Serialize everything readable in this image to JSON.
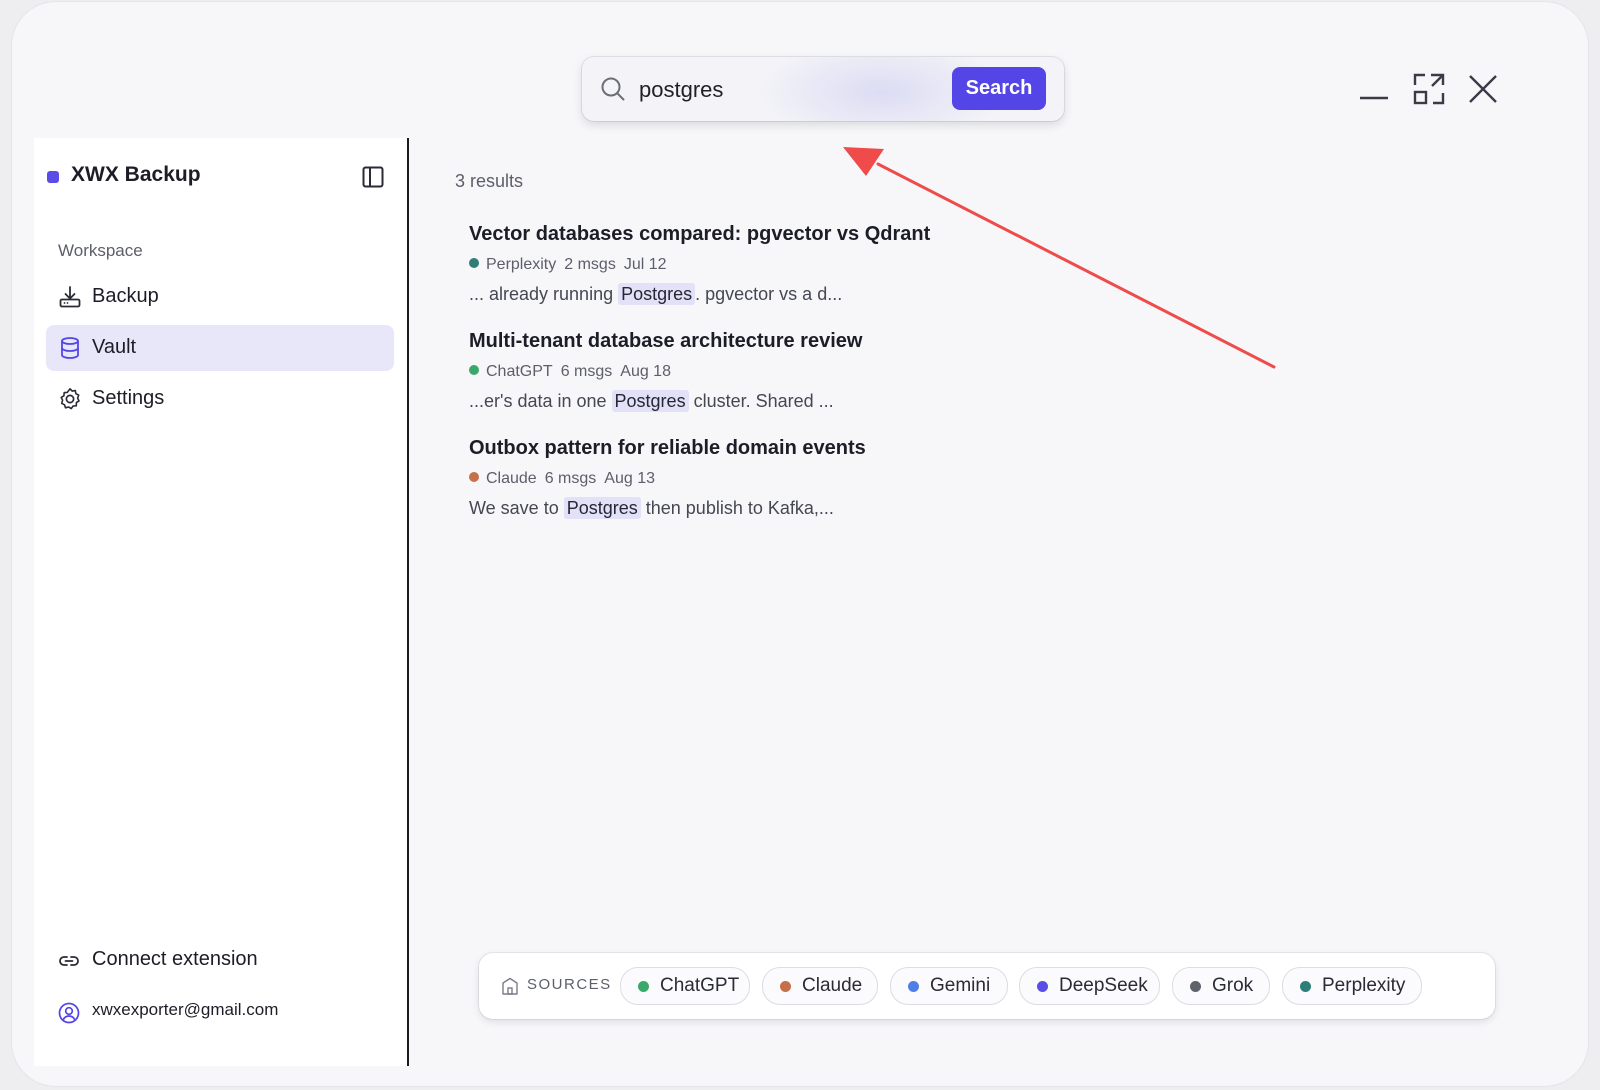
{
  "search": {
    "value": "postgres",
    "button_label": "Search"
  },
  "sidebar": {
    "brand": "XWX Backup",
    "section_label": "Workspace",
    "items": [
      {
        "label": "Backup",
        "icon": "download-tray-icon"
      },
      {
        "label": "Vault",
        "icon": "database-icon"
      },
      {
        "label": "Settings",
        "icon": "gear-icon"
      }
    ],
    "connect_label": "Connect extension",
    "account_email": "xwxexporter@gmail.com"
  },
  "results": {
    "count_text": "3 results",
    "items": [
      {
        "title": "Vector databases compared: pgvector vs Qdrant",
        "source": "Perplexity",
        "source_color": "#2f7d78",
        "msgs": "2 msgs",
        "date": "Jul 12",
        "snippet_before": "... already running ",
        "snippet_match": "Postgres",
        "snippet_after": ". pgvector vs a d..."
      },
      {
        "title": "Multi-tenant database architecture review",
        "source": "ChatGPT",
        "source_color": "#3aa86b",
        "msgs": "6 msgs",
        "date": "Aug 18",
        "snippet_before": "...er's data in one ",
        "snippet_match": "Postgres",
        "snippet_after": " cluster. Shared ..."
      },
      {
        "title": "Outbox pattern for reliable domain events",
        "source": "Claude",
        "source_color": "#c4704a",
        "msgs": "6 msgs",
        "date": "Aug 13",
        "snippet_before": "We save to ",
        "snippet_match": "Postgres",
        "snippet_after": " then publish to Kafka,..."
      }
    ]
  },
  "sources": {
    "label": "SOURCES",
    "chips": [
      {
        "label": "ChatGPT",
        "color": "#3aa86b"
      },
      {
        "label": "Claude",
        "color": "#c4704a"
      },
      {
        "label": "Gemini",
        "color": "#4f7fe6"
      },
      {
        "label": "DeepSeek",
        "color": "#5a4ee8"
      },
      {
        "label": "Grok",
        "color": "#5f6268"
      },
      {
        "label": "Perplexity",
        "color": "#2f7d78"
      }
    ]
  },
  "colors": {
    "accent": "#5345e6",
    "highlight": "#e3e1f7",
    "annotation_arrow": "#ef4b4b"
  }
}
